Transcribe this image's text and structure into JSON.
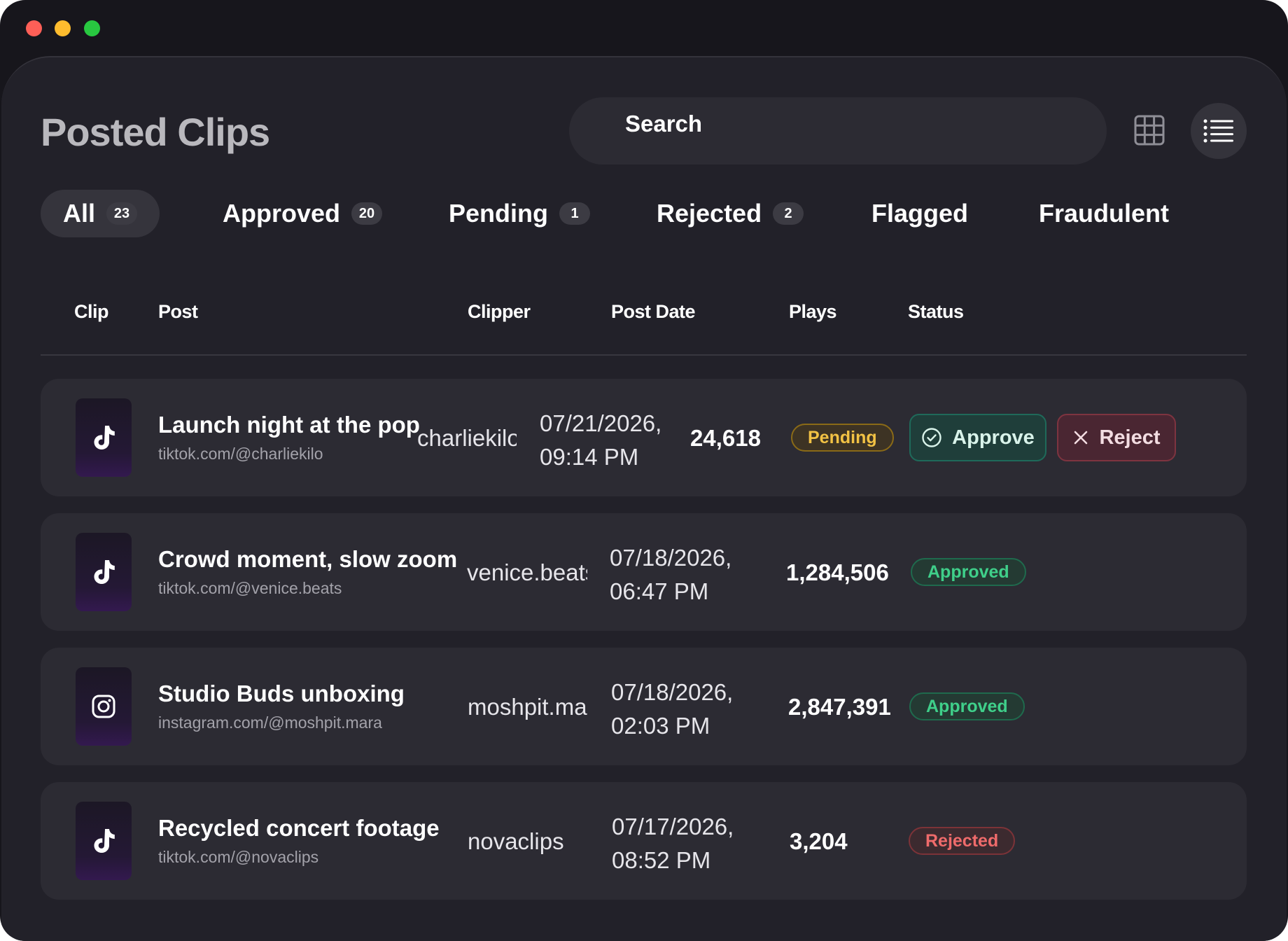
{
  "window": {
    "traffic_lights": [
      "close",
      "minimize",
      "zoom"
    ]
  },
  "header": {
    "title": "Posted Clips",
    "search_placeholder": "Search",
    "view_toggle": [
      "grid-icon",
      "list-icon"
    ]
  },
  "tabs": [
    {
      "label": "All",
      "count": "23",
      "active": true
    },
    {
      "label": "Approved",
      "count": "20"
    },
    {
      "label": "Pending",
      "count": "1"
    },
    {
      "label": "Rejected",
      "count": "2"
    },
    {
      "label": "Flagged"
    },
    {
      "label": "Fraudulent"
    }
  ],
  "table": {
    "columns": [
      "Clip",
      "Post",
      "Clipper",
      "Post Date",
      "Plays",
      "Status"
    ],
    "rows": [
      {
        "platform": "tiktok-icon",
        "title": "Launch night at the pop",
        "url": "tiktok.com/@charliekilo",
        "clipper": "charliekilo",
        "date_line1": "07/21/2026,",
        "date_line2": "09:14 PM",
        "plays": "24,618",
        "status": "Pending",
        "actions": {
          "approve": "Approve",
          "reject": "Reject"
        }
      },
      {
        "platform": "tiktok-icon",
        "title": "Crowd moment, slow zoom",
        "url": "tiktok.com/@venice.beats",
        "clipper": "venice.beats",
        "date_line1": "07/18/2026,",
        "date_line2": "06:47 PM",
        "plays": "1,284,506",
        "status": "Approved"
      },
      {
        "platform": "instagram-icon",
        "title": "Studio Buds unboxing",
        "url": "instagram.com/@moshpit.mara",
        "clipper": "moshpit.mara",
        "date_line1": "07/18/2026,",
        "date_line2": "02:03 PM",
        "plays": "2,847,391",
        "status": "Approved"
      },
      {
        "platform": "tiktok-icon",
        "title": "Recycled concert footage",
        "url": "tiktok.com/@novaclips",
        "clipper": "novaclips",
        "date_line1": "07/17/2026,",
        "date_line2": "08:52 PM",
        "plays": "3,204",
        "status": "Rejected"
      }
    ]
  },
  "colors": {
    "background": "#222129",
    "row": "#2c2b33",
    "pending": "#f2c244",
    "approved": "#3fcf8a",
    "rejected": "#ef6b6b"
  }
}
